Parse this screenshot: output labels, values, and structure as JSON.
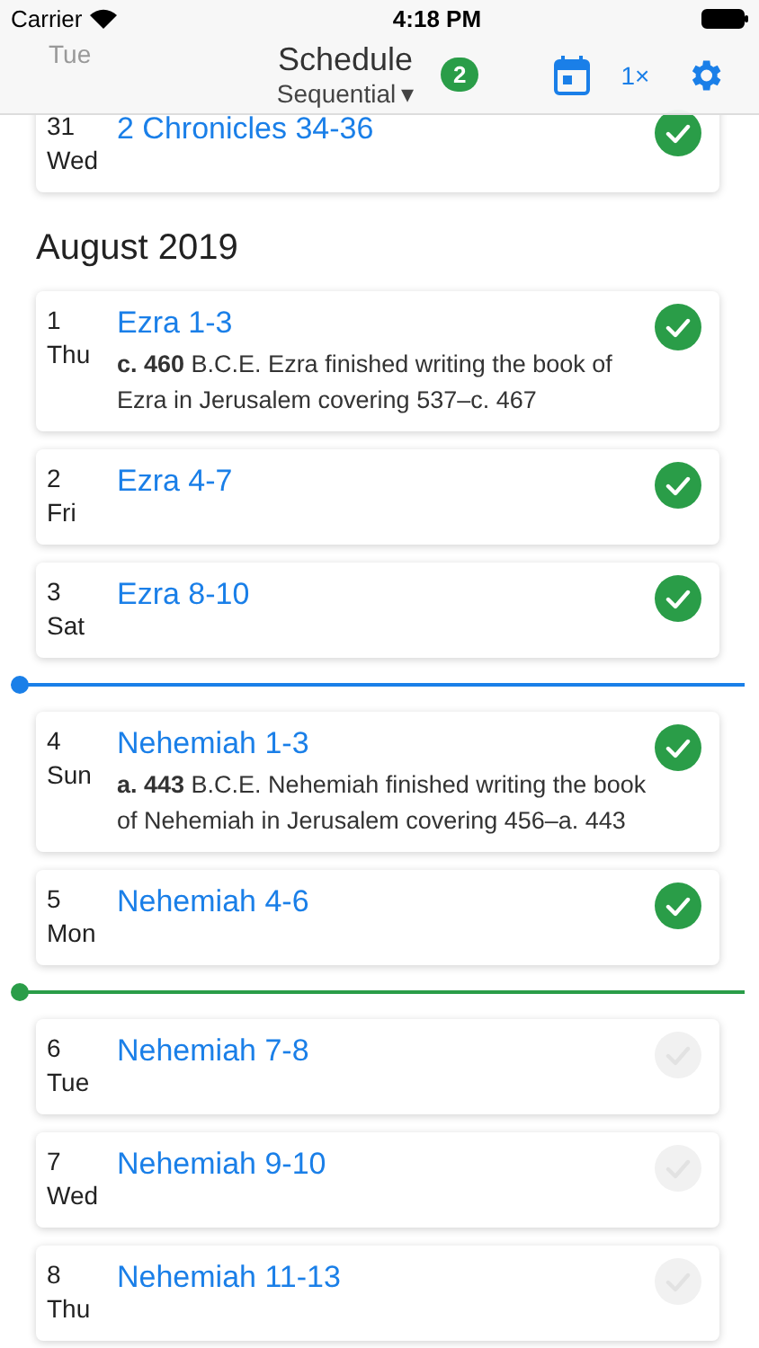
{
  "status_bar": {
    "carrier": "Carrier",
    "time": "4:18 PM"
  },
  "nav": {
    "title": "Schedule",
    "mode": "Sequential",
    "mode_caret": "▾",
    "badge": "2",
    "speed": "1×",
    "behind_text": "Tue"
  },
  "entries": [
    {
      "kind": "card",
      "date": "31",
      "day": "Wed",
      "title": "2 Chronicles 34-36",
      "done": true
    },
    {
      "kind": "heading",
      "text": "August 2019"
    },
    {
      "kind": "card",
      "date": "1",
      "day": "Thu",
      "title": "Ezra 1-3",
      "note": "**c. 460** B.C.E. Ezra finished writing the book of Ezra in Jerusalem covering 537–c. 467",
      "done": true
    },
    {
      "kind": "card",
      "date": "2",
      "day": "Fri",
      "title": "Ezra 4-7",
      "done": true
    },
    {
      "kind": "card",
      "date": "3",
      "day": "Sat",
      "title": "Ezra 8-10",
      "done": true
    },
    {
      "kind": "marker",
      "color": "#1a7fe8"
    },
    {
      "kind": "card",
      "date": "4",
      "day": "Sun",
      "title": "Nehemiah 1-3",
      "note": "**a. 443** B.C.E. Nehemiah finished writing the book of Nehemiah in Jerusalem covering 456–a. 443",
      "done": true
    },
    {
      "kind": "card",
      "date": "5",
      "day": "Mon",
      "title": "Nehemiah 4-6",
      "done": true
    },
    {
      "kind": "marker",
      "color": "#2a9d48"
    },
    {
      "kind": "card",
      "date": "6",
      "day": "Tue",
      "title": "Nehemiah 7-8",
      "done": false
    },
    {
      "kind": "card",
      "date": "7",
      "day": "Wed",
      "title": "Nehemiah 9-10",
      "done": false
    },
    {
      "kind": "card",
      "date": "8",
      "day": "Thu",
      "title": "Nehemiah 11-13",
      "done": false
    }
  ]
}
